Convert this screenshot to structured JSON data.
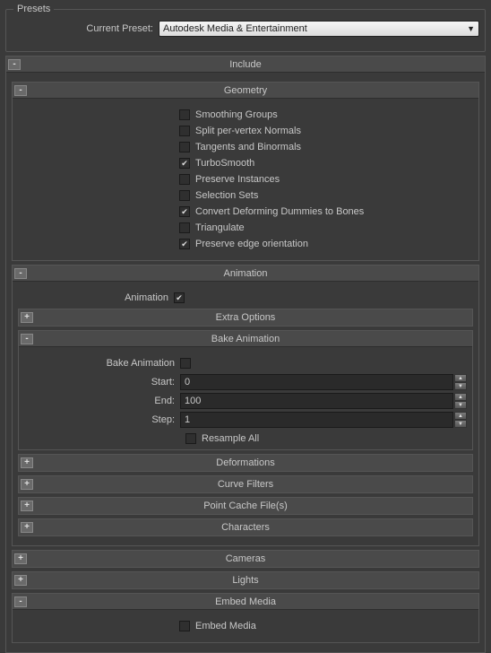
{
  "presets": {
    "legend": "Presets",
    "current_preset_label": "Current Preset:",
    "current_preset_value": "Autodesk Media & Entertainment"
  },
  "include": {
    "title": "Include",
    "geometry": {
      "title": "Geometry",
      "options": [
        {
          "label": "Smoothing Groups",
          "checked": false
        },
        {
          "label": "Split per-vertex Normals",
          "checked": false
        },
        {
          "label": "Tangents and Binormals",
          "checked": false
        },
        {
          "label": "TurboSmooth",
          "checked": true
        },
        {
          "label": "Preserve Instances",
          "checked": false
        },
        {
          "label": "Selection Sets",
          "checked": false
        },
        {
          "label": "Convert Deforming Dummies to Bones",
          "checked": true
        },
        {
          "label": "Triangulate",
          "checked": false
        },
        {
          "label": "Preserve edge orientation",
          "checked": true
        }
      ]
    },
    "animation": {
      "title": "Animation",
      "animation_label": "Animation",
      "animation_checked": true,
      "extra_options": {
        "title": "Extra Options"
      },
      "bake": {
        "title": "Bake Animation",
        "bake_label": "Bake Animation",
        "bake_checked": false,
        "start_label": "Start:",
        "start_value": "0",
        "end_label": "End:",
        "end_value": "100",
        "step_label": "Step:",
        "step_value": "1",
        "resample_label": "Resample All",
        "resample_checked": false
      },
      "deformations": {
        "title": "Deformations"
      },
      "curve_filters": {
        "title": "Curve Filters"
      },
      "point_cache": {
        "title": "Point Cache File(s)"
      },
      "characters": {
        "title": "Characters"
      }
    },
    "cameras": {
      "title": "Cameras"
    },
    "lights": {
      "title": "Lights"
    },
    "embed_media": {
      "title": "Embed Media",
      "label": "Embed Media",
      "checked": false
    }
  }
}
